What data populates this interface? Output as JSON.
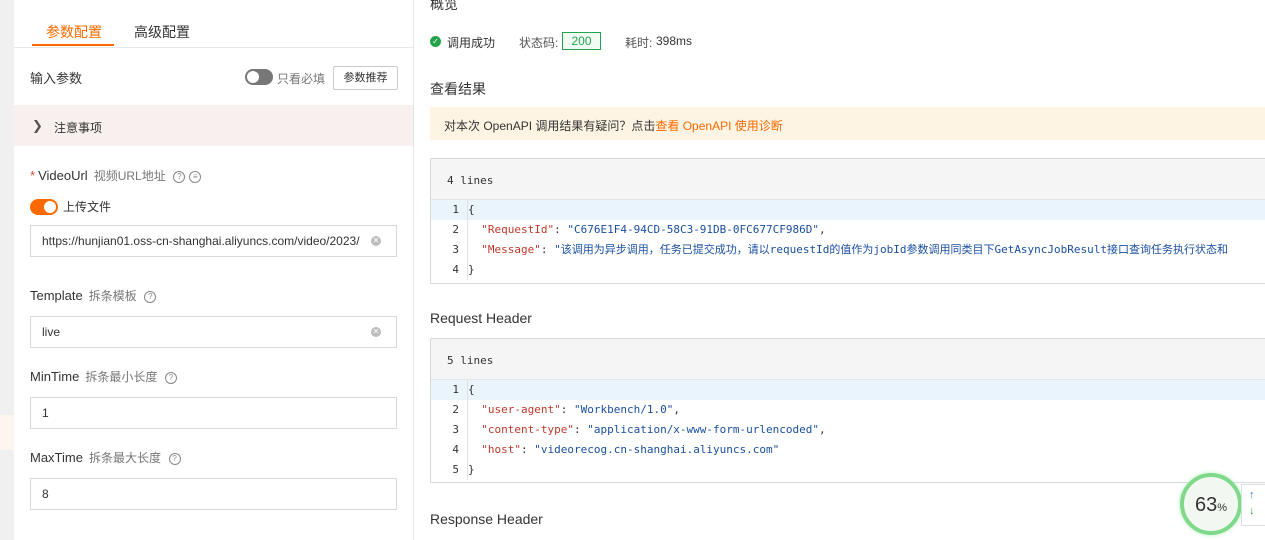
{
  "left_panel": {
    "tabs": [
      "参数配置",
      "高级配置"
    ],
    "input_params_label": "输入参数",
    "required_only_label": "只看必填",
    "recommend_button": "参数推荐",
    "notice_label": "注意事项",
    "fields": {
      "video_url": {
        "name": "VideoUrl",
        "desc": "视频URL地址",
        "upload_label": "上传文件",
        "value": "https://hunjian01.oss-cn-shanghai.aliyuncs.com/video/2023/"
      },
      "template": {
        "name": "Template",
        "desc": "拆条模板",
        "value": "live"
      },
      "min_time": {
        "name": "MinTime",
        "desc": "拆条最小长度",
        "value": "1"
      },
      "max_time": {
        "name": "MaxTime",
        "desc": "拆条最大长度",
        "value": "8"
      }
    }
  },
  "overview": {
    "title": "概览",
    "status_ok": "调用成功",
    "status_code_label": "状态码:",
    "status_code": "200",
    "time_label": "耗时:",
    "time_value": "398ms"
  },
  "result": {
    "title": "查看结果",
    "diag_text": "对本次 OpenAPI 调用结果有疑问？点击",
    "diag_link": "查看 OpenAPI 使用诊断",
    "lines_label": "4 lines",
    "line_numbers": [
      "1",
      "2",
      "3",
      "4"
    ],
    "brace_open": "{",
    "brace_close": "}",
    "request_id_key": "\"RequestId\"",
    "request_id_value": "\"C676E1F4-94CD-58C3-91DB-0FC677CF986D\"",
    "message_key": "\"Message\"",
    "message_value": "\"该调用为异步调用，任务已提交成功，请以requestId的值作为jobId参数调用同类目下GetAsyncJobResult接口查询任务执行状态和"
  },
  "request_header": {
    "title": "Request Header",
    "lines_label": "5 lines",
    "line_numbers": [
      "1",
      "2",
      "3",
      "4",
      "5"
    ],
    "ua_key": "\"user-agent\"",
    "ua_value": "\"Workbench/1.0\"",
    "ct_key": "\"content-type\"",
    "ct_value": "\"application/x-www-form-urlencoded\"",
    "host_key": "\"host\"",
    "host_value": "\"videorecog.cn-shanghai.aliyuncs.com\""
  },
  "response_header": {
    "title": "Response Header"
  },
  "progress_badge": {
    "value": "63",
    "unit": "%"
  },
  "colors": {
    "accent": "#ff6a00",
    "success": "#23a34b"
  }
}
